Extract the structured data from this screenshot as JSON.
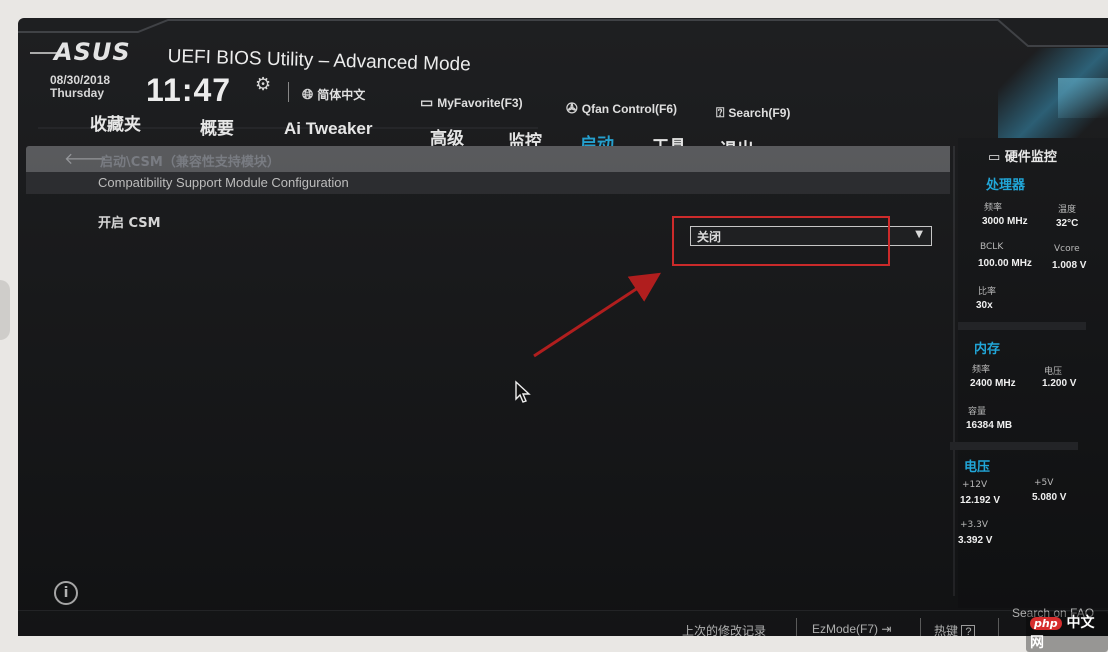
{
  "header": {
    "logo": "ASUS",
    "title": "UEFI BIOS Utility – Advanced Mode",
    "date": "08/30/2018",
    "day": "Thursday",
    "time": "11:47",
    "language": "简体中文",
    "my_favorite": "MyFavorite(F3)",
    "qfan": "Qfan Control(F6)",
    "search": "Search(F9)"
  },
  "tabs": [
    {
      "label": "收藏夹"
    },
    {
      "label": "概要"
    },
    {
      "label": "Ai Tweaker"
    },
    {
      "label": "高级"
    },
    {
      "label": "监控"
    },
    {
      "label": "启动",
      "active": true
    },
    {
      "label": "工具"
    },
    {
      "label": "退出"
    }
  ],
  "main": {
    "breadcrumb": "启动\\CSM（兼容性支持模块）",
    "subheading": "Compatibility Support Module Configuration",
    "setting_label": "开启 CSM",
    "setting_value": "关闭"
  },
  "hw_monitor": {
    "title": "硬件监控",
    "cpu": {
      "title": "处理器",
      "freq_label": "频率",
      "freq": "3000 MHz",
      "temp_label": "温度",
      "temp": "32°C",
      "bclk_label": "BCLK",
      "bclk": "100.00 MHz",
      "vcore_label": "Vcore",
      "vcore": "1.008 V",
      "ratio_label": "比率",
      "ratio": "30x"
    },
    "memory": {
      "title": "内存",
      "freq_label": "频率",
      "freq": "2400 MHz",
      "volt_label": "电压",
      "volt": "1.200 V",
      "cap_label": "容量",
      "cap": "16384 MB"
    },
    "voltage": {
      "title": "电压",
      "v12_label": "+12V",
      "v12": "12.192 V",
      "v5_label": "+5V",
      "v5": "5.080 V",
      "v33_label": "+3.3V",
      "v33": "3.392 V"
    }
  },
  "footer": {
    "last_modified": "上次的修改记录",
    "ezmode": "EzMode(F7)",
    "hotkeys": "热键",
    "hotkey_key": "?",
    "search_faq": "Search on FAQ"
  },
  "watermark": {
    "brand": "php",
    "text": "中文网"
  },
  "colors": {
    "accent": "#21a6d8",
    "highlight": "#e02a2a",
    "background": "#17181a"
  },
  "icons": [
    "gear-icon",
    "globe-icon",
    "favorite-icon",
    "fan-icon",
    "search-icon",
    "back-arrow-icon",
    "info-icon",
    "monitor-icon",
    "exit-icon",
    "mouse-pointer-icon"
  ]
}
